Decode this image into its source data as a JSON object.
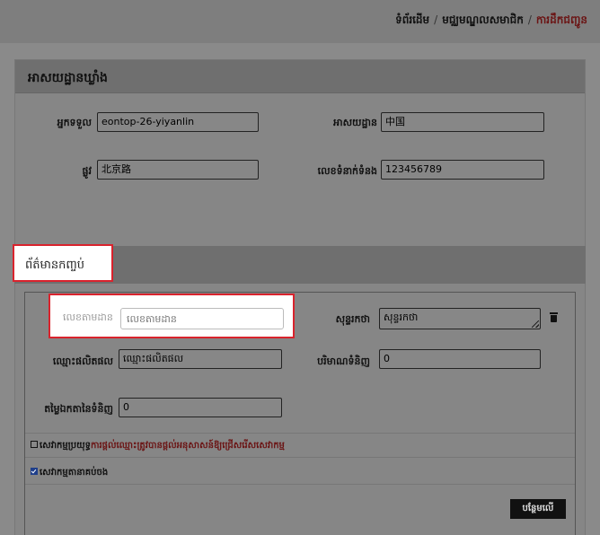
{
  "breadcrumb": {
    "home": "ទំព័រដើម",
    "member_center": "មជ្ឈមណ្ឌលសមាជិក",
    "current": "ការដឹកជញ្ជូន"
  },
  "warehouse_section": {
    "title": "អាសយដ្ឋានឃ្លាំង",
    "recipient_label": "អ្នកទទួល",
    "recipient_value": "eontop-26-yiyanlin",
    "address_label": "អាសយដ្ឋាន",
    "address_value": "中国",
    "street_label": "ផ្លូវ",
    "street_value": "北京路",
    "phone_label": "លេខទំនាក់ទំនង",
    "phone_value": "123456789"
  },
  "package_section": {
    "tab_label": "ព័ត៌មានកញ្ចប់",
    "tracking_label": "លេខតាមដាន",
    "tracking_placeholder": "លេខតាមដាន",
    "note_label": "សុន្ទរកថា",
    "note_value": "សុន្ទរកថា",
    "product_name_label": "ឈ្មោះផលិតផល",
    "product_name_value": "ឈ្មោះផលិតផល",
    "quantity_label": "បរិមាណទំនិញ",
    "quantity_value": "0",
    "unit_price_label": "តម្លៃឯកតានៃទំនិញ",
    "unit_price_value": "0",
    "check_inspect_prefix": "សេវាកម្មប្រយុទ្ធ",
    "check_inspect_warning": "ការផ្តល់ឈ្មោះត្រូវបានផ្តល់អនុសាសន៍ឱ្យជ្រើសរើសសេវាកម្ម",
    "check_inspect_checked": false,
    "check_other_label": "សេវាកម្មតានាគប់ចង",
    "check_other_checked": true,
    "add_button": "បន្ថែមលើ"
  },
  "colors": {
    "highlight": "#d9232d",
    "link_active": "#6b1414",
    "checkbox_on": "#1f3f8a"
  }
}
